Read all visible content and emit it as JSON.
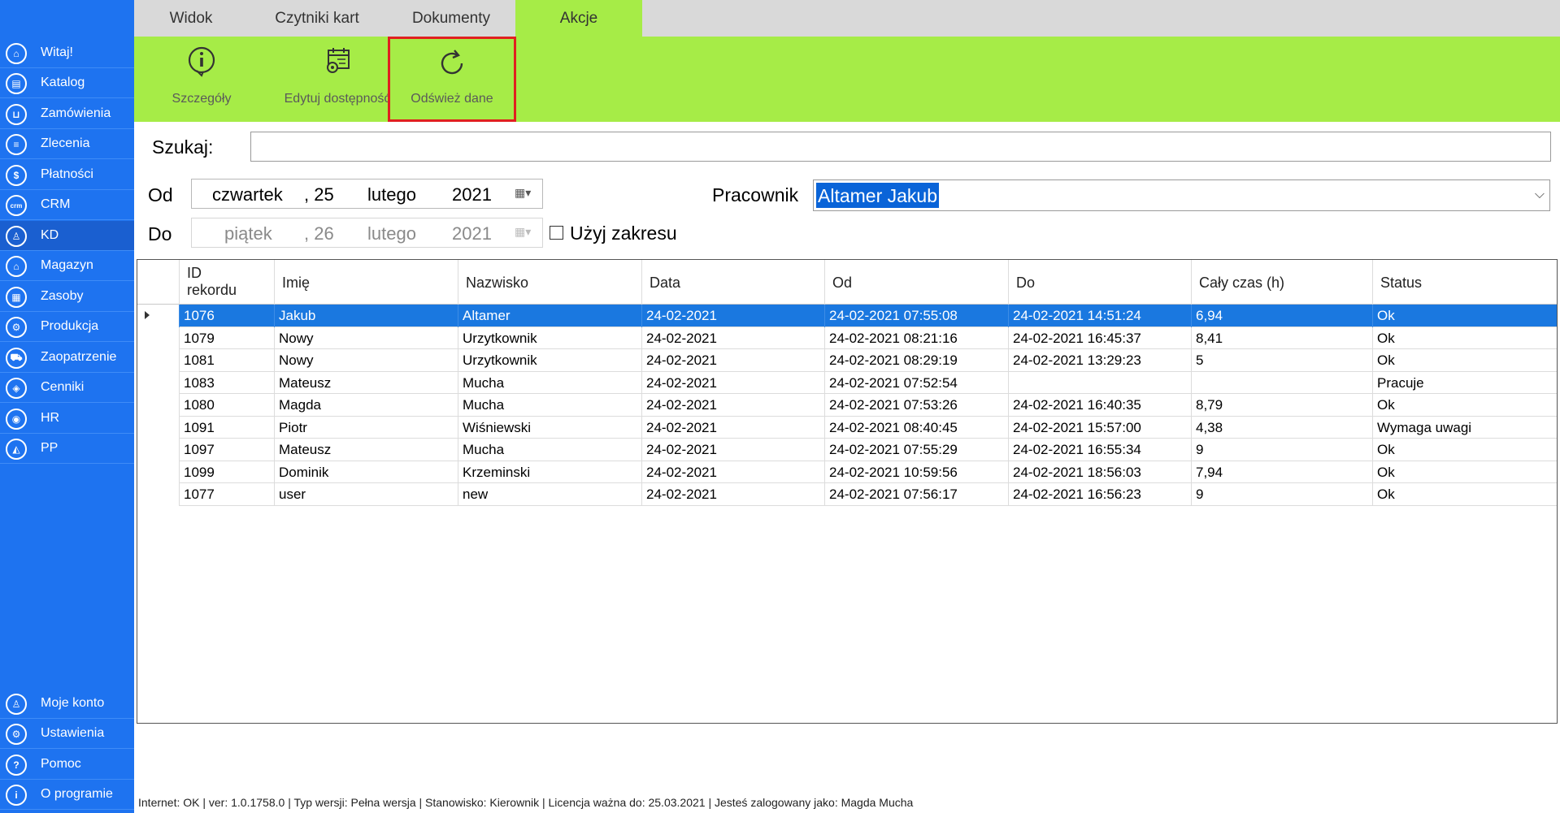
{
  "sidebar": {
    "items": [
      {
        "label": "Witaj!",
        "icon": "home-icon",
        "glyph": "⌂"
      },
      {
        "label": "Katalog",
        "icon": "book-icon",
        "glyph": "▤"
      },
      {
        "label": "Zamówienia",
        "icon": "cart-icon",
        "glyph": "⊔"
      },
      {
        "label": "Zlecenia",
        "icon": "list-icon",
        "glyph": "≡"
      },
      {
        "label": "Płatności",
        "icon": "dollar-icon",
        "glyph": "$"
      },
      {
        "label": "CRM",
        "icon": "crm-icon",
        "glyph": "crm"
      },
      {
        "label": "KD",
        "icon": "person-icon",
        "glyph": "♙"
      },
      {
        "label": "Magazyn",
        "icon": "warehouse-icon",
        "glyph": "⌂"
      },
      {
        "label": "Zasoby",
        "icon": "resources-icon",
        "glyph": "▦"
      },
      {
        "label": "Produkcja",
        "icon": "production-icon",
        "glyph": "⚙"
      },
      {
        "label": "Zaopatrzenie",
        "icon": "truck-icon",
        "glyph": "⛟"
      },
      {
        "label": "Cenniki",
        "icon": "tag-icon",
        "glyph": "◈"
      },
      {
        "label": "HR",
        "icon": "hr-icon",
        "glyph": "◉"
      },
      {
        "label": "PP",
        "icon": "chart-icon",
        "glyph": "◭"
      }
    ],
    "bottom_items": [
      {
        "label": "Moje konto",
        "icon": "account-icon",
        "glyph": "♙"
      },
      {
        "label": "Ustawienia",
        "icon": "settings-icon",
        "glyph": "⚙"
      },
      {
        "label": "Pomoc",
        "icon": "help-icon",
        "glyph": "?"
      },
      {
        "label": "O programie",
        "icon": "info-icon",
        "glyph": "i"
      }
    ],
    "active": "KD"
  },
  "tabs": [
    {
      "label": "Widok"
    },
    {
      "label": "Czytniki kart"
    },
    {
      "label": "Dokumenty"
    },
    {
      "label": "Akcje"
    }
  ],
  "active_tab": "Akcje",
  "ribbon": {
    "details_label": "Szczegóły",
    "edit_availability_label": "Edytuj dostępność",
    "refresh_label": "Odśwież dane"
  },
  "search": {
    "label": "Szukaj:",
    "value": ""
  },
  "date_from": {
    "label": "Od",
    "weekday": "czwartek",
    "day": ", 25",
    "month": "lutego",
    "year": "2021"
  },
  "date_to": {
    "label": "Do",
    "weekday": "piątek",
    "day": ", 26",
    "month": "lutego",
    "year": "2021"
  },
  "use_range": {
    "label": "Użyj zakresu",
    "checked": false
  },
  "employee": {
    "label": "Pracownik",
    "value": "Altamer Jakub"
  },
  "grid": {
    "headers": [
      "ID rekordu",
      "Imię",
      "Nazwisko",
      "Data",
      "Od",
      "Do",
      "Cały czas (h)",
      "Status"
    ],
    "header_id_line1": "ID",
    "header_id_line2": "rekordu",
    "rows": [
      [
        "1076",
        "Jakub",
        "Altamer",
        "24-02-2021",
        "24-02-2021 07:55:08",
        "24-02-2021 14:51:24",
        "6,94",
        "Ok"
      ],
      [
        "1079",
        "Nowy",
        "Urzytkownik",
        "24-02-2021",
        "24-02-2021 08:21:16",
        "24-02-2021 16:45:37",
        "8,41",
        "Ok"
      ],
      [
        "1081",
        "Nowy",
        "Urzytkownik",
        "24-02-2021",
        "24-02-2021 08:29:19",
        "24-02-2021 13:29:23",
        "5",
        "Ok"
      ],
      [
        "1083",
        "Mateusz",
        "Mucha",
        "24-02-2021",
        "24-02-2021 07:52:54",
        "",
        "",
        "Pracuje"
      ],
      [
        "1080",
        "Magda",
        "Mucha",
        "24-02-2021",
        "24-02-2021 07:53:26",
        "24-02-2021 16:40:35",
        "8,79",
        "Ok"
      ],
      [
        "1091",
        "Piotr",
        "Wiśniewski",
        "24-02-2021",
        "24-02-2021 08:40:45",
        "24-02-2021 15:57:00",
        "4,38",
        "Wymaga uwagi"
      ],
      [
        "1097",
        "Mateusz",
        "Mucha",
        "24-02-2021",
        "24-02-2021 07:55:29",
        "24-02-2021 16:55:34",
        "9",
        "Ok"
      ],
      [
        "1099",
        "Dominik",
        "Krzeminski",
        "24-02-2021",
        "24-02-2021 10:59:56",
        "24-02-2021 18:56:03",
        "7,94",
        "Ok"
      ],
      [
        "1077",
        "user",
        "new",
        "24-02-2021",
        "24-02-2021 07:56:17",
        "24-02-2021 16:56:23",
        "9",
        "Ok"
      ]
    ],
    "selected_row": 0
  },
  "statusbar": {
    "text": "Internet: OK  |   ver: 1.0.1758.0   |   Typ wersji: Pełna wersja   |   Stanowisko: Kierownik   |   Licencja ważna do: 25.03.2021   |   Jesteś zalogowany jako: Magda Mucha"
  },
  "colors": {
    "sidebar": "#1e73f0",
    "ribbon": "#a6ec47",
    "selection": "#1a78e0",
    "highlight_border": "#e02020"
  }
}
